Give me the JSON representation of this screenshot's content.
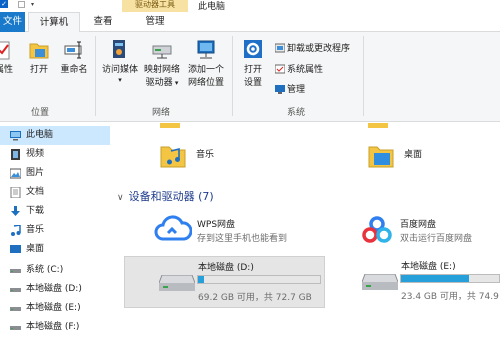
{
  "titlebar": {
    "context_tab": "驱动器工具",
    "title": "此电脑",
    "check_glyph": "✓"
  },
  "tabs": {
    "file": "文件",
    "computer": "计算机",
    "view": "查看",
    "manage": "管理"
  },
  "ribbon": {
    "location": {
      "label": "位置",
      "properties": "属性",
      "open": "打开",
      "rename": "重命名"
    },
    "network": {
      "label": "网络",
      "access_media": "访问媒体",
      "map_drive_line1": "映射网络",
      "map_drive_line2": "驱动器",
      "add_location_line1": "添加一个",
      "add_location_line2": "网络位置"
    },
    "system": {
      "label": "系统",
      "open_settings_line1": "打开",
      "open_settings_line2": "设置",
      "uninstall": "卸载或更改程序",
      "system_properties": "系统属性",
      "manage": "管理"
    }
  },
  "nav": {
    "items": [
      {
        "label": "此电脑",
        "icon": "pc-icon"
      },
      {
        "label": "视频",
        "icon": "video-icon"
      },
      {
        "label": "图片",
        "icon": "picture-icon"
      },
      {
        "label": "文档",
        "icon": "document-icon"
      },
      {
        "label": "下载",
        "icon": "download-icon"
      },
      {
        "label": "音乐",
        "icon": "music-icon"
      },
      {
        "label": "桌面",
        "icon": "desktop-icon"
      },
      {
        "label": "系统 (C:)",
        "icon": "drive-icon"
      },
      {
        "label": "本地磁盘 (D:)",
        "icon": "drive-icon"
      },
      {
        "label": "本地磁盘 (E:)",
        "icon": "drive-icon"
      },
      {
        "label": "本地磁盘 (F:)",
        "icon": "drive-icon"
      }
    ]
  },
  "content": {
    "folders": [
      {
        "label": "音乐",
        "icon": "music-folder-icon"
      },
      {
        "label": "桌面",
        "icon": "desktop-folder-icon"
      }
    ],
    "section_title": "设备和驱动器 (7)",
    "chevron": "∨",
    "devices": [
      {
        "name": "WPS网盘",
        "sub": "存到这里手机也能看到",
        "icon": "wps-cloud-icon"
      },
      {
        "name": "百度网盘",
        "sub": "双击运行百度网盘",
        "icon": "baidu-netdisk-icon"
      }
    ],
    "drives": [
      {
        "name": "本地磁盘 (D:)",
        "sub": "69.2 GB 可用，共 72.7 GB",
        "used_fraction": 0.05,
        "selected": true
      },
      {
        "name": "本地磁盘 (E:)",
        "sub": "23.4 GB 可用，共 74.9",
        "used_fraction": 0.69,
        "selected": false
      }
    ]
  },
  "colors": {
    "accent": "#1979ca",
    "selection": "#cce8ff",
    "bar_fill": "#26a0da",
    "section_title": "#1e3c8c",
    "context_tab": "#f7e2a3"
  }
}
